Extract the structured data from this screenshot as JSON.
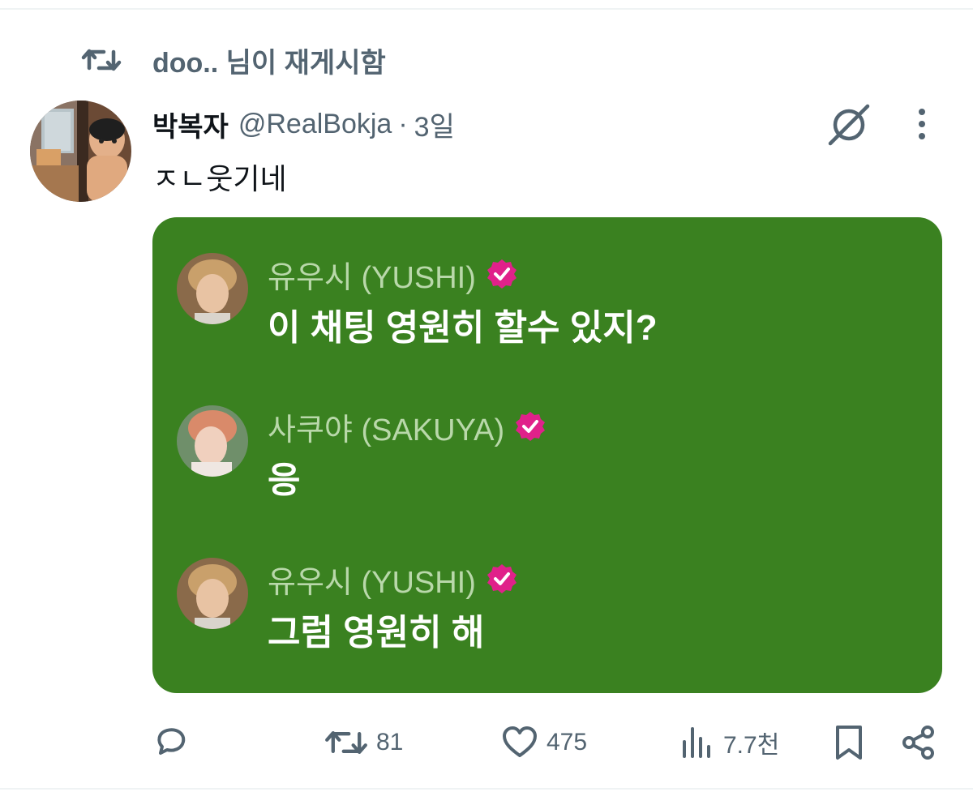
{
  "repost": {
    "text": "doo.. 님이 재게시함",
    "icon": "repost-icon"
  },
  "tweet": {
    "display_name": "박복자",
    "handle": "@RealBokja",
    "separator": "·",
    "time": "3일",
    "text": "ㅈㄴ웃기네",
    "avatar_icon": "avatar-image"
  },
  "media": {
    "background_color": "#3a8120",
    "messages": [
      {
        "name": "유우시 (YUSHI)",
        "text": "이 채팅 영원히 할수 있지?",
        "verified_color": "#e0218a"
      },
      {
        "name": "사쿠야 (SAKUYA)",
        "text": "응",
        "verified_color": "#e0218a"
      },
      {
        "name": "유우시 (YUSHI)",
        "text": "그럼 영원히 해",
        "verified_color": "#e0218a"
      }
    ]
  },
  "actions": {
    "reply": {
      "icon": "reply-icon",
      "count": ""
    },
    "repost": {
      "icon": "repost-icon",
      "count": "81"
    },
    "like": {
      "icon": "heart-icon",
      "count": "475"
    },
    "views": {
      "icon": "views-icon",
      "count": "7.7천"
    },
    "bookmark": {
      "icon": "bookmark-icon"
    },
    "share": {
      "icon": "share-icon"
    }
  },
  "colors": {
    "text_primary": "#0f1419",
    "text_secondary": "#536471",
    "accent_verified": "#e0218a"
  }
}
